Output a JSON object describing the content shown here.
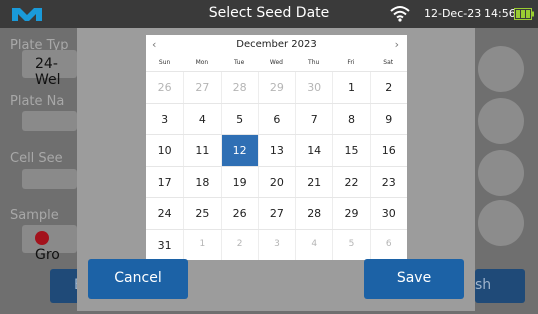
{
  "status_bar": {
    "title": "Select Seed Date",
    "date": "12-Dec-23",
    "time": "14:56",
    "icons": [
      "logo-icon",
      "wifi-icon",
      "battery-icon"
    ]
  },
  "background": {
    "plate_type_label": "Plate Typ",
    "plate_type_value": "24-Wel",
    "plate_name_label": "Plate Na",
    "cell_seed_label": "Cell See",
    "sample_label": "Sample",
    "sample_value": "Gro",
    "left_button_label": "E",
    "right_button_label": "sh"
  },
  "calendar": {
    "month_label": "December 2023",
    "prev_symbol": "‹",
    "next_symbol": "›",
    "weekdays": [
      "Sun",
      "Mon",
      "Tue",
      "Wed",
      "Thu",
      "Fri",
      "Sat"
    ],
    "weeks": [
      [
        "26",
        "27",
        "28",
        "29",
        "30",
        "1",
        "2"
      ],
      [
        "3",
        "4",
        "5",
        "6",
        "7",
        "8",
        "9"
      ],
      [
        "10",
        "11",
        "12",
        "13",
        "14",
        "15",
        "16"
      ],
      [
        "17",
        "18",
        "19",
        "20",
        "21",
        "22",
        "23"
      ],
      [
        "24",
        "25",
        "26",
        "27",
        "28",
        "29",
        "30"
      ],
      [
        "31",
        "1",
        "2",
        "3",
        "4",
        "5",
        "6"
      ]
    ],
    "selected": "12"
  },
  "buttons": {
    "cancel_label": "Cancel",
    "save_label": "Save"
  },
  "colors": {
    "accent": "#1c62a6",
    "selected_day": "#2f6fb4",
    "status_bar": "#3a3a3a",
    "sample_dot": "#a3121c",
    "battery": "#9acd32"
  }
}
